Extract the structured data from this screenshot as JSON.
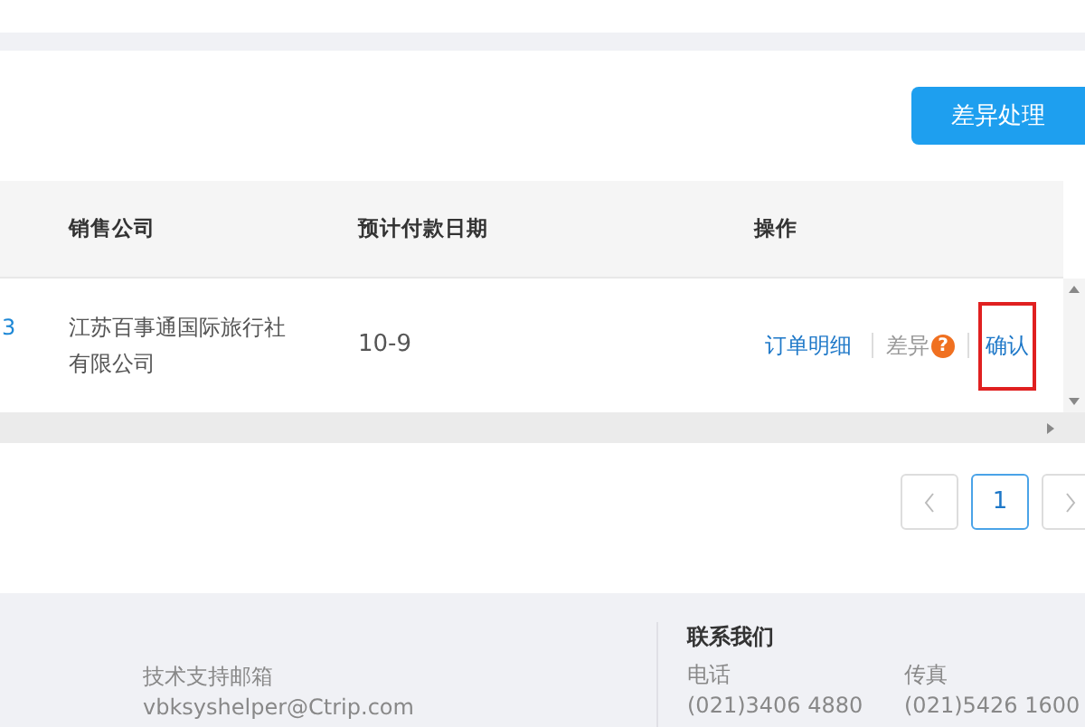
{
  "toolbar": {
    "button": "差异处理"
  },
  "table": {
    "columns": [
      "销售公司",
      "预计付款日期",
      "操作"
    ],
    "rows": [
      {
        "column_1": "3",
        "company": "江苏百事通国际旅行社有限公司",
        "date": "10-9",
        "actions": [
          {
            "kind": "link",
            "label": "订单明细"
          },
          {
            "kind": "help",
            "label": "差异",
            "icon": "?"
          },
          {
            "kind": "link",
            "label": "确认",
            "highlighted": true
          }
        ]
      }
    ]
  },
  "pagination": {
    "pages": [
      {
        "label": "1",
        "selected": true
      }
    ]
  },
  "footer": {
    "support": {
      "label": "技术支持邮箱",
      "email": "vbksyshelper@Ctrip.com"
    },
    "contact": {
      "title": "联系我们",
      "items": [
        {
          "label": "电话",
          "value": "(021)3406 4880"
        },
        {
          "label": "传真",
          "value": "(021)5426 1600"
        }
      ]
    }
  }
}
